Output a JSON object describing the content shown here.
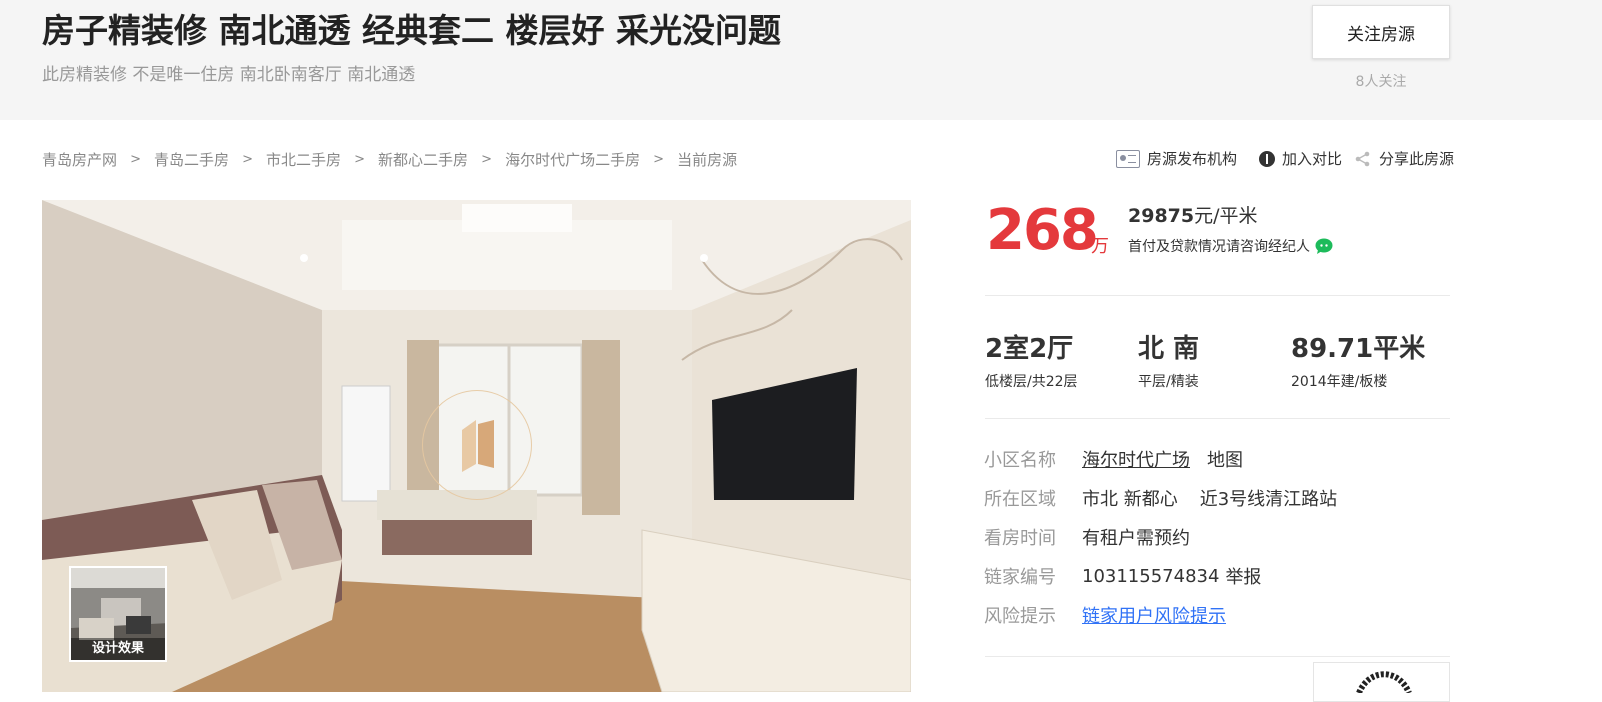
{
  "header": {
    "title": "房子精装修 南北通透 经典套二 楼层好 采光没问题",
    "subtitle": "此房精装修 不是唯一住房 南北卧南客厅 南北通透",
    "follow_label": "关注房源",
    "follow_count": "8人关注"
  },
  "breadcrumb": {
    "items": [
      "青岛房产网",
      "青岛二手房",
      "市北二手房",
      "新都心二手房",
      "海尔时代广场二手房"
    ],
    "current": "当前房源",
    "separator": ">"
  },
  "actions": {
    "agency_label": "房源发布机构",
    "compare_label": "加入对比",
    "share_label": "分享此房源"
  },
  "photo": {
    "thumb_label": "设计效果"
  },
  "price": {
    "total": "268",
    "total_unit": "万",
    "unit_price_value": "29875",
    "unit_price_suffix": "元/平米",
    "down_payment": "首付及贷款情况请咨询经纪人",
    "total_color": "#e4393c"
  },
  "room": {
    "layout_main": "2室2厅",
    "layout_sub": "低楼层/共22层",
    "orientation_main": "北 南",
    "orientation_sub": "平层/精装",
    "area_main": "89.71平米",
    "area_sub": "2014年建/板楼"
  },
  "info": {
    "community_label": "小区名称",
    "community_value": "海尔时代广场",
    "community_map": "地图",
    "district_label": "所在区域",
    "district_value": "市北 新都心",
    "district_extra": "近3号线清江路站",
    "visit_label": "看房时间",
    "visit_value": "有租户需预约",
    "code_label": "链家编号",
    "code_value": "103115574834",
    "code_report": "举报",
    "risk_label": "风险提示",
    "risk_value": "链家用户风险提示",
    "link_color": "#3072f6"
  }
}
